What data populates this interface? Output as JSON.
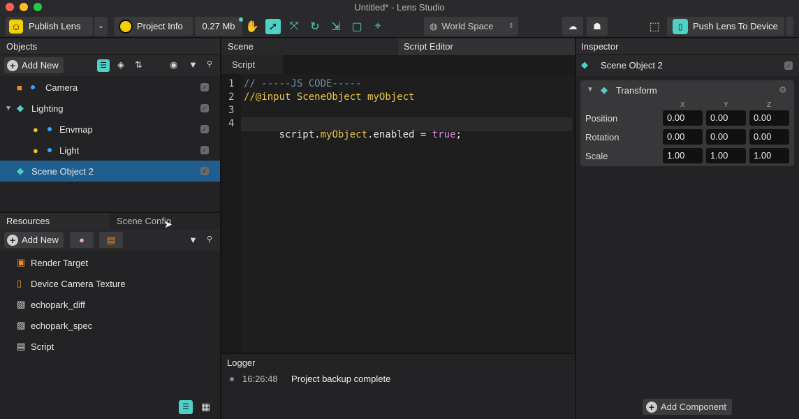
{
  "window": {
    "title": "Untitled* - Lens Studio"
  },
  "toolbar": {
    "publish_label": "Publish Lens",
    "project_info_label": "Project Info",
    "size_label": "0.27 Mb",
    "space_label": "World Space",
    "push_label": "Push Lens To Device"
  },
  "objects": {
    "header": "Objects",
    "add_new": "Add New",
    "items": [
      {
        "label": "Camera"
      },
      {
        "label": "Lighting"
      },
      {
        "label": "Envmap"
      },
      {
        "label": "Light"
      },
      {
        "label": "Scene Object 2"
      }
    ]
  },
  "resources": {
    "tab_resources": "Resources",
    "tab_scene_config": "Scene Config",
    "add_new": "Add New",
    "items": [
      {
        "label": "Render Target"
      },
      {
        "label": "Device Camera Texture"
      },
      {
        "label": "echopark_diff"
      },
      {
        "label": "echopark_spec"
      },
      {
        "label": "Script"
      }
    ]
  },
  "editor": {
    "tab_scene": "Scene",
    "tab_script_editor": "Script Editor",
    "file_tab": "Script",
    "line_numbers": [
      "1",
      "2",
      "3",
      "4"
    ],
    "line1": "// -----JS CODE-----",
    "line2": "//@input SceneObject myObject",
    "line4_a": "script.",
    "line4_b": "myObject",
    "line4_c": ".enabled = ",
    "line4_d": "true",
    "line4_e": ";"
  },
  "logger": {
    "header": "Logger",
    "time": "16:26:48",
    "message": "Project backup complete"
  },
  "inspector": {
    "header": "Inspector",
    "object_name": "Scene Object 2",
    "component": "Transform",
    "axes": [
      "X",
      "Y",
      "Z"
    ],
    "rows": [
      {
        "label": "Position",
        "values": [
          "0.00",
          "0.00",
          "0.00"
        ]
      },
      {
        "label": "Rotation",
        "values": [
          "0.00",
          "0.00",
          "0.00"
        ]
      },
      {
        "label": "Scale",
        "values": [
          "1.00",
          "1.00",
          "1.00"
        ]
      }
    ],
    "add_component": "Add Component"
  },
  "colors": {
    "accent": "#4fd1c5",
    "selected_row": "#1f5f8f",
    "publish_yellow": "#f5d000"
  }
}
